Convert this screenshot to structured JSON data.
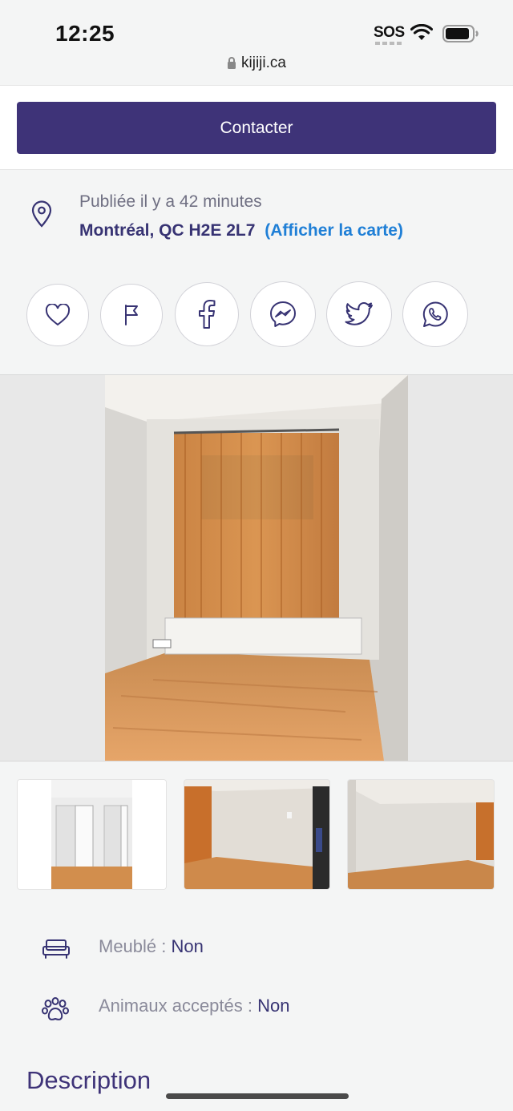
{
  "status_bar": {
    "time": "12:25",
    "carrier": "SOS",
    "url": "kijiji.ca"
  },
  "contact": {
    "button_label": "Contacter"
  },
  "listing": {
    "posted": "Publiée il y a 42 minutes",
    "address": "Montréal, QC H2E 2L7",
    "map_link": "(Afficher la carte)"
  },
  "actions": [
    {
      "icon": "heart-icon"
    },
    {
      "icon": "flag-icon"
    },
    {
      "icon": "facebook-icon"
    },
    {
      "icon": "messenger-icon"
    },
    {
      "icon": "twitter-icon"
    },
    {
      "icon": "whatsapp-icon"
    }
  ],
  "attributes": {
    "furnished": {
      "label": "Meublé :",
      "value": "Non",
      "icon": "sofa-icon"
    },
    "pets": {
      "label": "Animaux acceptés :",
      "value": "Non",
      "icon": "paw-icon"
    }
  },
  "description": {
    "title": "Description"
  },
  "colors": {
    "brand": "#3e3378",
    "link": "#1f7fd6",
    "background": "#f4f5f5"
  }
}
